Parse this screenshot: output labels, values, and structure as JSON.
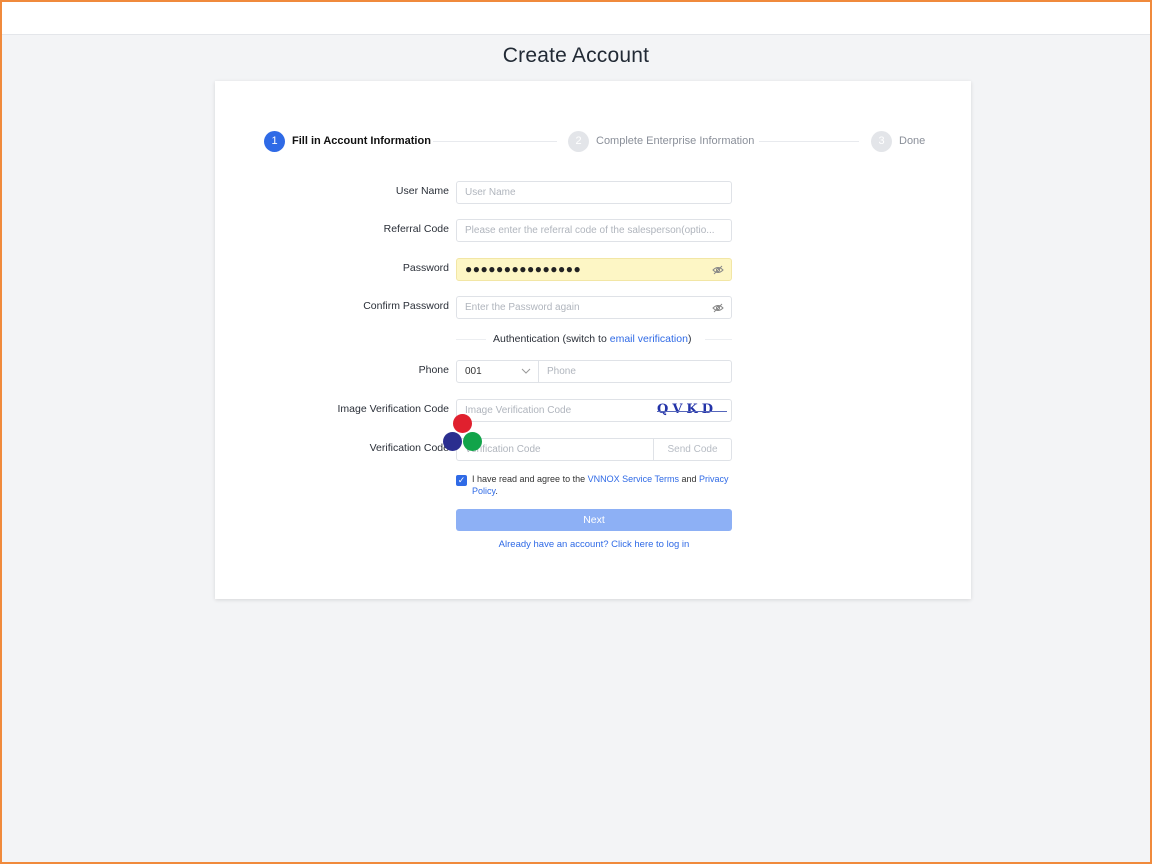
{
  "page": {
    "title": "Create Account"
  },
  "steps": [
    {
      "num": "1",
      "label": "Fill in Account Information",
      "state": "active"
    },
    {
      "num": "2",
      "label": "Complete Enterprise Information",
      "state": "inactive"
    },
    {
      "num": "3",
      "label": "Done",
      "state": "inactive"
    }
  ],
  "form": {
    "username": {
      "label": "User Name",
      "placeholder": "User Name"
    },
    "referral": {
      "label": "Referral Code",
      "placeholder": "Please enter the referral code of the salesperson(optio..."
    },
    "password": {
      "label": "Password",
      "value": "●●●●●●●●●●●●●●●"
    },
    "confirm": {
      "label": "Confirm Password",
      "placeholder": "Enter the Password again"
    },
    "auth": {
      "text": "Authentication (switch to ",
      "link": "email verification",
      "suffix": ")"
    },
    "phone": {
      "label": "Phone",
      "country_code": "001",
      "placeholder": "Phone"
    },
    "image_code": {
      "label": "Image Verification Code",
      "placeholder": "Image Verification Code",
      "captcha": "QVKD"
    },
    "verify_code": {
      "label": "Verification Code",
      "placeholder": "Verification Code",
      "send_label": "Send Code"
    },
    "terms": {
      "prefix": "I have read and agree to the ",
      "service_link": "VNNOX Service Terms",
      "and": " and ",
      "privacy_link": "Privacy Policy",
      "suffix": "."
    },
    "next_label": "Next",
    "login_link": "Already have an account? Click here to log in"
  },
  "colors": {
    "accent": "#2f6ae6",
    "dot_red": "#e0202e",
    "dot_navy": "#2b2e8f",
    "dot_green": "#12a44a"
  }
}
